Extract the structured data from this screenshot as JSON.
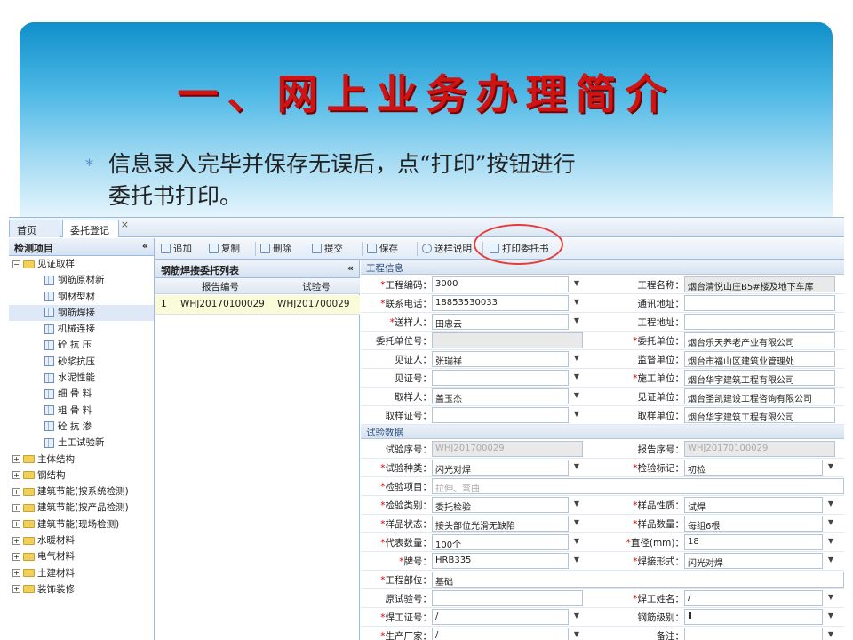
{
  "slide": {
    "title": "一、网上业务办理简介",
    "bullet_mark": "*",
    "bullet_line1": "信息录入完毕并保存无误后，点“打印”按钮进行",
    "bullet_line2": "委托书打印。"
  },
  "tabs": {
    "home": "首页",
    "active": "委托登记",
    "close": "×"
  },
  "sidebar": {
    "title": "检测项目",
    "collapse": "«",
    "items": [
      {
        "label": "见证取样",
        "type": "folder",
        "exp": "−"
      },
      {
        "label": "钢筋原材新",
        "type": "leaf"
      },
      {
        "label": "钢材型材",
        "type": "leaf"
      },
      {
        "label": "钢筋焊接",
        "type": "leaf"
      },
      {
        "label": "机械连接",
        "type": "leaf"
      },
      {
        "label": "砼 抗 压",
        "type": "leaf"
      },
      {
        "label": "砂浆抗压",
        "type": "leaf"
      },
      {
        "label": "水泥性能",
        "type": "leaf"
      },
      {
        "label": "细 骨 料",
        "type": "leaf"
      },
      {
        "label": "粗 骨 料",
        "type": "leaf"
      },
      {
        "label": "砼 抗 渗",
        "type": "leaf"
      },
      {
        "label": "土工试验新",
        "type": "leaf"
      },
      {
        "label": "主体结构",
        "type": "folder",
        "exp": "+"
      },
      {
        "label": "钢结构",
        "type": "folder",
        "exp": "+"
      },
      {
        "label": "建筑节能(按系统检测)",
        "type": "folder",
        "exp": "+"
      },
      {
        "label": "建筑节能(按产品检测)",
        "type": "folder",
        "exp": "+"
      },
      {
        "label": "建筑节能(现场检测)",
        "type": "folder",
        "exp": "+"
      },
      {
        "label": "水暖材料",
        "type": "folder",
        "exp": "+"
      },
      {
        "label": "电气材料",
        "type": "folder",
        "exp": "+"
      },
      {
        "label": "土建材料",
        "type": "folder",
        "exp": "+"
      },
      {
        "label": "装饰装修",
        "type": "folder",
        "exp": "+"
      }
    ]
  },
  "toolbar": {
    "add": "追加",
    "copy": "复制",
    "delete": "删除",
    "submit": "提交",
    "save": "保存",
    "sample_note": "送样说明",
    "print": "打印委托书"
  },
  "list": {
    "title": "钢筋焊接委托列表",
    "collapse": "«",
    "col_report": "报告编号",
    "col_test": "试验号",
    "rows": [
      {
        "num": "1",
        "report": "WHJ20170100029",
        "test": "WHJ201700029"
      }
    ]
  },
  "form": {
    "section1": "工程信息",
    "section2": "试验数据",
    "req": "*",
    "dd": "▼",
    "fields": {
      "project_code": {
        "label": "工程编码：",
        "value": "3000"
      },
      "project_name": {
        "label": "工程名称：",
        "value": "烟台清悦山庄B5#楼及地下车库"
      },
      "phone": {
        "label": "联系电话：",
        "value": "18853530033"
      },
      "address": {
        "label": "通讯地址：",
        "value": ""
      },
      "sender": {
        "label": "送样人：",
        "value": "田忠云"
      },
      "site_address": {
        "label": "工程地址：",
        "value": ""
      },
      "unit_no": {
        "label": "委托单位号：",
        "value": ""
      },
      "client_unit": {
        "label": "委托单位：",
        "value": "烟台乐天养老产业有限公司"
      },
      "witness": {
        "label": "见证人：",
        "value": "张瑞祥"
      },
      "supervise_unit": {
        "label": "监督单位：",
        "value": "烟台市福山区建筑业管理处"
      },
      "witness_no": {
        "label": "见证号：",
        "value": ""
      },
      "construct_unit": {
        "label": "施工单位：",
        "value": "烟台华宇建筑工程有限公司"
      },
      "sampler": {
        "label": "取样人：",
        "value": "盖玉杰"
      },
      "witness_unit": {
        "label": "见证单位：",
        "value": "烟台圣凯建设工程咨询有限公司"
      },
      "sampler_no": {
        "label": "取样证号：",
        "value": ""
      },
      "sample_unit": {
        "label": "取样单位：",
        "value": "烟台华宇建筑工程有限公司"
      },
      "test_seq": {
        "label": "试验序号：",
        "value": "WHJ201700029"
      },
      "report_seq": {
        "label": "报告序号：",
        "value": "WHJ20170100029"
      },
      "test_type": {
        "label": "试验种类：",
        "value": "闪光对焊"
      },
      "test_mark": {
        "label": "检验标记：",
        "value": "初检"
      },
      "test_items": {
        "label": "检验项目：",
        "value": "拉伸、弯曲"
      },
      "test_category": {
        "label": "检验类别：",
        "value": "委托检验"
      },
      "sample_nature": {
        "label": "样品性质：",
        "value": "试焊"
      },
      "sample_state": {
        "label": "样品状态：",
        "value": "接头部位光滑无缺陷"
      },
      "sample_count": {
        "label": "样品数量：",
        "value": "每组6根"
      },
      "rep_count": {
        "label": "代表数量：",
        "value": "100个"
      },
      "diameter": {
        "label": "直径(mm)：",
        "value": "18"
      },
      "grade": {
        "label": "牌号：",
        "value": "HRB335"
      },
      "weld_form": {
        "label": "焊接形式：",
        "value": "闪光对焊"
      },
      "project_part": {
        "label": "工程部位：",
        "value": "基础"
      },
      "orig_test_no": {
        "label": "原试验号：",
        "value": ""
      },
      "welder_name": {
        "label": "焊工姓名：",
        "value": "/"
      },
      "welder_cert": {
        "label": "焊工证号：",
        "value": "/"
      },
      "steel_level": {
        "label": "钢筋级别：",
        "value": "Ⅱ"
      },
      "manufacturer": {
        "label": "生产厂家：",
        "value": "/"
      },
      "remark": {
        "label": "备注：",
        "value": ""
      }
    }
  }
}
